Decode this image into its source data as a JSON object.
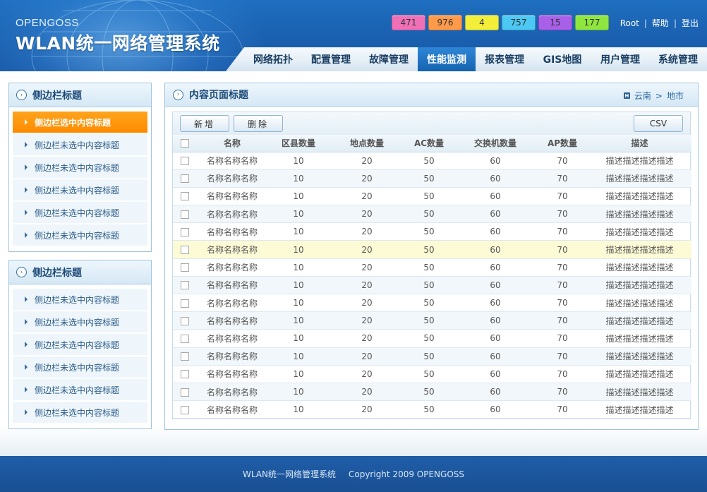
{
  "header": {
    "brand_small": "OPENGOSS",
    "brand_title": "WLAN统一网络管理系统",
    "counters": [
      {
        "value": "471",
        "color": "#f070b8"
      },
      {
        "value": "976",
        "color": "#ff9a4a"
      },
      {
        "value": "4",
        "color": "#f2ee3a"
      },
      {
        "value": "757",
        "color": "#4cc8f2"
      },
      {
        "value": "15",
        "color": "#a860e8"
      },
      {
        "value": "177",
        "color": "#8ee63e"
      }
    ],
    "links": {
      "user": "Root",
      "help": "帮助",
      "logout": "登出",
      "separator": "|"
    }
  },
  "nav": {
    "items": [
      {
        "label": "网络拓扑"
      },
      {
        "label": "配置管理"
      },
      {
        "label": "故障管理"
      },
      {
        "label": "性能监测",
        "active": true
      },
      {
        "label": "报表管理"
      },
      {
        "label": "GIS地图"
      },
      {
        "label": "用户管理"
      },
      {
        "label": "系统管理"
      }
    ]
  },
  "sidebar": {
    "box1": {
      "title": "侧边栏标题",
      "items": [
        {
          "label": "侧边栏选中内容标题",
          "selected": true
        },
        {
          "label": "侧边栏未选中内容标题"
        },
        {
          "label": "侧边栏未选中内容标题"
        },
        {
          "label": "侧边栏未选中内容标题"
        },
        {
          "label": "侧边栏未选中内容标题"
        },
        {
          "label": "侧边栏未选中内容标题"
        }
      ]
    },
    "box2": {
      "title": "侧边栏标题",
      "items": [
        {
          "label": "侧边栏未选中内容标题"
        },
        {
          "label": "侧边栏未选中内容标题"
        },
        {
          "label": "侧边栏未选中内容标题"
        },
        {
          "label": "侧边栏未选中内容标题"
        },
        {
          "label": "侧边栏未选中内容标题"
        },
        {
          "label": "侧边栏未选中内容标题"
        }
      ]
    }
  },
  "main": {
    "title": "内容页面标题",
    "breadcrumb": {
      "province": "云南",
      "separator": ">",
      "city": "地市"
    },
    "toolbar": {
      "add": "新增",
      "delete": "删除",
      "csv": "CSV"
    },
    "table": {
      "columns": [
        "名称",
        "区县数量",
        "地点数量",
        "AC数量",
        "交换机数量",
        "AP数量",
        "描述"
      ],
      "highlight_row": 5,
      "rows": [
        [
          "名称名称名称",
          "10",
          "20",
          "50",
          "60",
          "70",
          "描述描述描述描述"
        ],
        [
          "名称名称名称",
          "10",
          "20",
          "50",
          "60",
          "70",
          "描述描述描述描述"
        ],
        [
          "名称名称名称",
          "10",
          "20",
          "50",
          "60",
          "70",
          "描述描述描述描述"
        ],
        [
          "名称名称名称",
          "10",
          "20",
          "50",
          "60",
          "70",
          "描述描述描述描述"
        ],
        [
          "名称名称名称",
          "10",
          "20",
          "50",
          "60",
          "70",
          "描述描述描述描述"
        ],
        [
          "名称名称名称",
          "10",
          "20",
          "50",
          "60",
          "70",
          "描述描述描述描述"
        ],
        [
          "名称名称名称",
          "10",
          "20",
          "50",
          "60",
          "70",
          "描述描述描述描述"
        ],
        [
          "名称名称名称",
          "10",
          "20",
          "50",
          "60",
          "70",
          "描述描述描述描述"
        ],
        [
          "名称名称名称",
          "10",
          "20",
          "50",
          "60",
          "70",
          "描述描述描述描述"
        ],
        [
          "名称名称名称",
          "10",
          "20",
          "50",
          "60",
          "70",
          "描述描述描述描述"
        ],
        [
          "名称名称名称",
          "10",
          "20",
          "50",
          "60",
          "70",
          "描述描述描述描述"
        ],
        [
          "名称名称名称",
          "10",
          "20",
          "50",
          "60",
          "70",
          "描述描述描述描述"
        ],
        [
          "名称名称名称",
          "10",
          "20",
          "50",
          "60",
          "70",
          "描述描述描述描述"
        ],
        [
          "名称名称名称",
          "10",
          "20",
          "50",
          "60",
          "70",
          "描述描述描述描述"
        ],
        [
          "名称名称名称",
          "10",
          "20",
          "50",
          "60",
          "70",
          "描述描述描述描述"
        ]
      ]
    }
  },
  "footer": {
    "system_name": "WLAN统一网络管理系统",
    "copyright": "Copyright 2009 OPENGOSS"
  }
}
